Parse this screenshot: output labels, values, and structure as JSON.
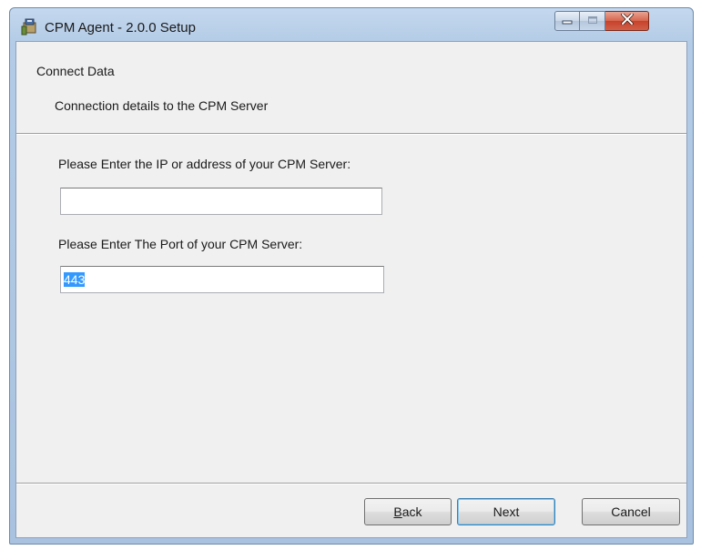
{
  "window": {
    "title": "CPM Agent - 2.0.0 Setup",
    "icon": "installer-icon",
    "controls": {
      "minimize": "minimize-icon",
      "maximize": "maximize-icon",
      "close": "close-icon"
    }
  },
  "header": {
    "title": "Connect Data",
    "subtitle": "Connection details to the CPM Server"
  },
  "form": {
    "ip_label": "Please Enter the IP or address of your CPM Server:",
    "ip_value": "",
    "port_label": "Please Enter The Port of your CPM Server:",
    "port_value": "443"
  },
  "buttons": {
    "back_prefix": "B",
    "back_rest": "ack",
    "next": "Next",
    "cancel": "Cancel"
  },
  "colors": {
    "selection": "#3399ff",
    "close_button": "#c8412a",
    "titlebar": "#b3cbe6"
  }
}
